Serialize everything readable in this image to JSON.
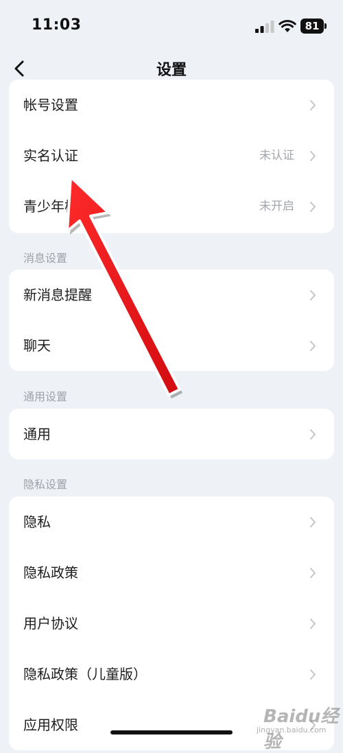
{
  "status_bar": {
    "time": "11:03",
    "battery": "81",
    "icons": [
      "cellular-signal-icon",
      "wifi-icon",
      "battery-icon"
    ]
  },
  "nav": {
    "title": "设置",
    "back_icon": "chevron-left-icon"
  },
  "account_card": {
    "items": [
      {
        "label": "帐号设置",
        "value": ""
      },
      {
        "label": "实名认证",
        "value": "未认证"
      },
      {
        "label": "青少年模式",
        "value": "未开启"
      }
    ]
  },
  "message_section": {
    "header": "消息设置",
    "items": [
      {
        "label": "新消息提醒"
      },
      {
        "label": "聊天"
      }
    ]
  },
  "general_section": {
    "header": "通用设置",
    "items": [
      {
        "label": "通用"
      }
    ]
  },
  "privacy_section": {
    "header": "隐私设置",
    "items": [
      {
        "label": "隐私"
      },
      {
        "label": "隐私政策"
      },
      {
        "label": "用户协议"
      },
      {
        "label": "隐私政策（儿童版）"
      },
      {
        "label": "应用权限"
      }
    ]
  },
  "watermark": {
    "text": "Baidu经验",
    "sub": "jingyan.baidu.com"
  },
  "colors": {
    "background": "#eef1f6",
    "card": "#ffffff",
    "secondary_text": "#a3a6ad",
    "annotation_arrow": "#e8141a"
  }
}
